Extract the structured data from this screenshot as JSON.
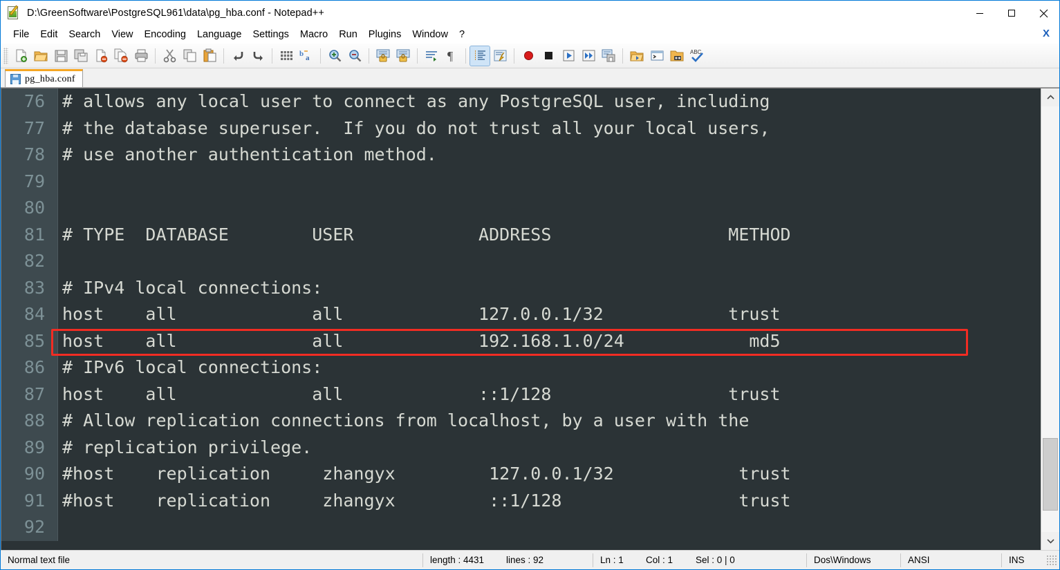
{
  "window": {
    "title": "D:\\GreenSoftware\\PostgreSQL961\\data\\pg_hba.conf - Notepad++",
    "app_icon": "notepad-plus-plus-icon",
    "minimize_label": "—",
    "maximize_label": "□",
    "close_label": "✕",
    "accent_border": "#0078d7"
  },
  "menubar": {
    "items": [
      {
        "label": "File"
      },
      {
        "label": "Edit"
      },
      {
        "label": "Search"
      },
      {
        "label": "View"
      },
      {
        "label": "Encoding"
      },
      {
        "label": "Language"
      },
      {
        "label": "Settings"
      },
      {
        "label": "Macro"
      },
      {
        "label": "Run"
      },
      {
        "label": "Plugins"
      },
      {
        "label": "Window"
      },
      {
        "label": "?"
      }
    ],
    "close_document_label": "X"
  },
  "toolbar": {
    "groups": [
      [
        "new-file-icon",
        "open-file-icon",
        "save-icon",
        "save-all-icon",
        "close-file-icon",
        "close-all-files-icon",
        "print-icon"
      ],
      [
        "cut-icon",
        "copy-icon",
        "paste-icon"
      ],
      [
        "undo-icon",
        "redo-icon"
      ],
      [
        "find-icon",
        "replace-icon"
      ],
      [
        "zoom-in-icon",
        "zoom-out-icon"
      ],
      [
        "sync-vertical-scroll-icon",
        "sync-horizontal-scroll-icon"
      ],
      [
        "word-wrap-icon",
        "show-all-characters-icon"
      ],
      [
        "show-indent-guide-icon",
        "user-defined-language-icon"
      ],
      [
        "start-record-macro-icon",
        "stop-record-macro-icon",
        "play-macro-icon",
        "run-macro-multiple-icon",
        "save-macro-icon"
      ],
      [
        "run-icon",
        "launch-console-icon",
        "open-folder-as-workspace-icon",
        "spell-check-icon"
      ]
    ],
    "active_button": "show-indent-guide-icon"
  },
  "tabs": [
    {
      "label": "pg_hba.conf",
      "icon": "saved-disk-icon",
      "active": true
    }
  ],
  "editor": {
    "background": "#2b3336",
    "gutter_background": "#3e4a4f",
    "text_color": "#d6d9d2",
    "line_number_color": "#7d9196",
    "annotation_color": "#f22c23",
    "annotated_line": 85,
    "lines": [
      {
        "num": "76",
        "text": "# allows any local user to connect as any PostgreSQL user, including"
      },
      {
        "num": "77",
        "text": "# the database superuser.  If you do not trust all your local users,"
      },
      {
        "num": "78",
        "text": "# use another authentication method."
      },
      {
        "num": "79",
        "text": ""
      },
      {
        "num": "80",
        "text": ""
      },
      {
        "num": "81",
        "text": "# TYPE  DATABASE        USER            ADDRESS                 METHOD"
      },
      {
        "num": "82",
        "text": ""
      },
      {
        "num": "83",
        "text": "# IPv4 local connections:"
      },
      {
        "num": "84",
        "text": "host    all             all             127.0.0.1/32            trust"
      },
      {
        "num": "85",
        "text": "host    all             all             192.168.1.0/24            md5"
      },
      {
        "num": "86",
        "text": "# IPv6 local connections:"
      },
      {
        "num": "87",
        "text": "host    all             all             ::1/128                 trust"
      },
      {
        "num": "88",
        "text": "# Allow replication connections from localhost, by a user with the"
      },
      {
        "num": "89",
        "text": "# replication privilege."
      },
      {
        "num": "90",
        "text": "#host    replication     zhangyx         127.0.0.1/32            trust"
      },
      {
        "num": "91",
        "text": "#host    replication     zhangyx         ::1/128                 trust"
      },
      {
        "num": "92",
        "text": ""
      }
    ]
  },
  "scrollbar": {
    "up_arrow": "chevron-up-icon",
    "down_arrow": "chevron-down-icon",
    "thumb_top_pct": 78,
    "thumb_height_pct": 17
  },
  "statusbar": {
    "file_type": "Normal text file",
    "length": "length : 4431",
    "lines": "lines : 92",
    "ln": "Ln : 1",
    "col": "Col : 1",
    "sel": "Sel : 0 | 0",
    "eol": "Dos\\Windows",
    "encoding": "ANSI",
    "insert_mode": "INS"
  }
}
